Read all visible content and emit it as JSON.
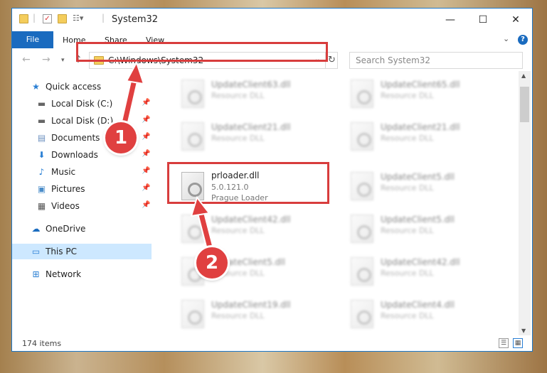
{
  "window": {
    "title": "System32"
  },
  "ribbon": {
    "file": "File",
    "tabs": [
      "Home",
      "Share",
      "View"
    ],
    "help": "?"
  },
  "address": {
    "path": "C:\\Windows\\System32"
  },
  "search": {
    "placeholder": "Search System32"
  },
  "sidebar": {
    "items": [
      {
        "label": "Quick access",
        "icon": "star-icon"
      },
      {
        "label": "Local Disk (C:)",
        "icon": "drive-icon",
        "pinned": true
      },
      {
        "label": "Local Disk (D:)",
        "icon": "drive-icon",
        "pinned": true
      },
      {
        "label": "Documents",
        "icon": "documents-icon",
        "pinned": true
      },
      {
        "label": "Downloads",
        "icon": "downloads-icon",
        "pinned": true
      },
      {
        "label": "Music",
        "icon": "music-icon",
        "pinned": true
      },
      {
        "label": "Pictures",
        "icon": "pictures-icon",
        "pinned": true
      },
      {
        "label": "Videos",
        "icon": "videos-icon",
        "pinned": true
      },
      {
        "label": "OneDrive",
        "icon": "cloud-icon"
      },
      {
        "label": "This PC",
        "icon": "computer-icon",
        "selected": true
      },
      {
        "label": "Network",
        "icon": "network-icon"
      }
    ]
  },
  "files": [
    {
      "name": "UpdateClient63.dll",
      "desc": "Resource DLL"
    },
    {
      "name": "UpdateClient65.dll",
      "desc": "Resource DLL"
    },
    {
      "name": "UpdateClient21.dll",
      "desc": "Resource DLL"
    },
    {
      "name": "UpdateClient21.dll",
      "desc": "Resource DLL"
    },
    {
      "name": "prloader.dll",
      "version": "5.0.121.0",
      "desc": "Prague Loader",
      "highlight": true
    },
    {
      "name": "UpdateClient5.dll",
      "desc": "Resource DLL"
    },
    {
      "name": "UpdateClient42.dll",
      "desc": "Resource DLL"
    },
    {
      "name": "UpdateClient5.dll",
      "desc": "Resource DLL"
    },
    {
      "name": "UpdateClient5.dll",
      "desc": "Resource DLL"
    },
    {
      "name": "UpdateClient42.dll",
      "desc": "Resource DLL"
    },
    {
      "name": "UpdateClient19.dll",
      "desc": "Resource DLL"
    },
    {
      "name": "UpdateClient4.dll",
      "desc": "Resource DLL"
    }
  ],
  "status": {
    "count": "174 items"
  },
  "callouts": [
    "1",
    "2"
  ],
  "colors": {
    "accent": "#1a6bbf",
    "highlight": "#d83d3d",
    "selected": "#cde8ff"
  }
}
